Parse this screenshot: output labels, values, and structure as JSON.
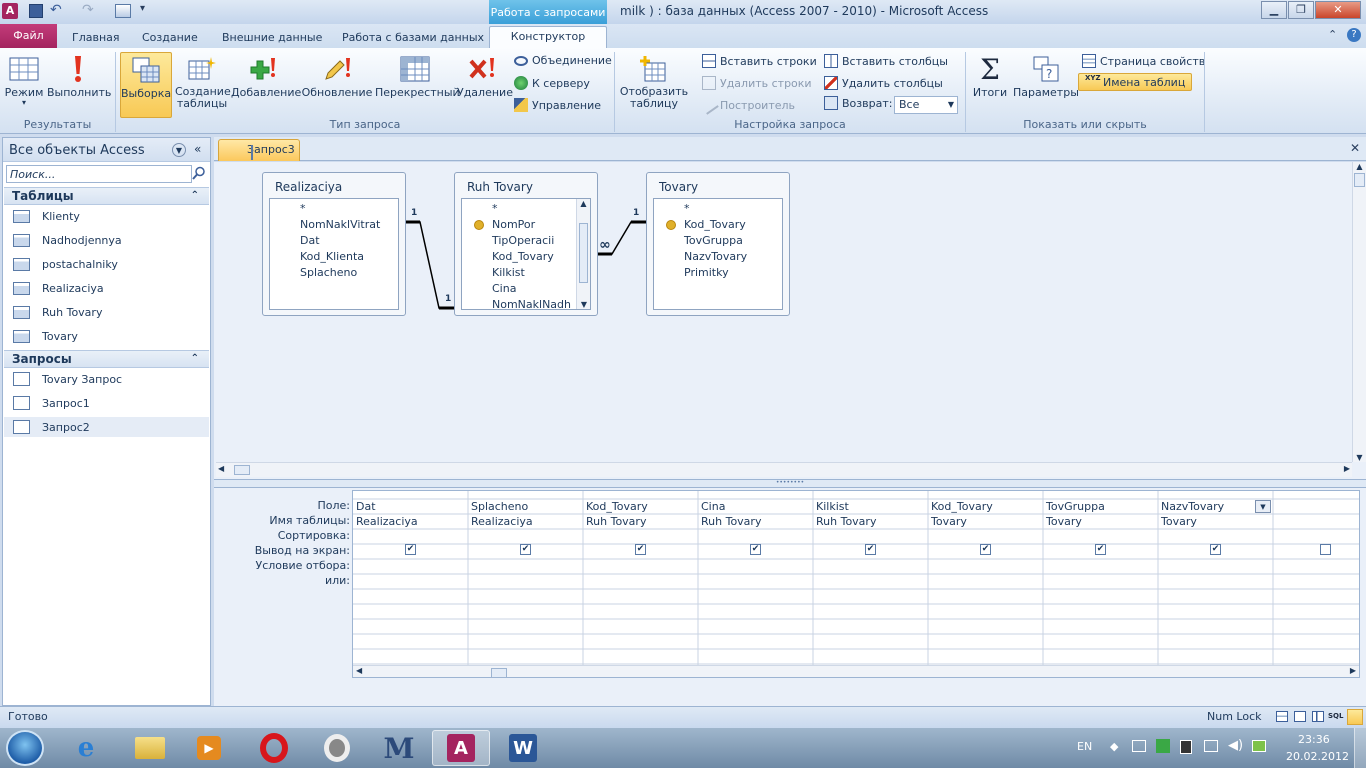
{
  "window": {
    "title": "milk ) : база данных (Access 2007 - 2010)  -  Microsoft Access",
    "context_tab_header": "Работа с запросами"
  },
  "tabs": {
    "file": "Файл",
    "items": [
      "Главная",
      "Создание",
      "Внешние данные",
      "Работа с базами данных",
      "Конструктор"
    ]
  },
  "ribbon": {
    "results": {
      "label": "Результаты",
      "mode": "Режим",
      "run": "Выполнить"
    },
    "query_type": {
      "label": "Тип запроса",
      "select": "Выборка",
      "make_table_1": "Создание",
      "make_table_2": "таблицы",
      "append": "Добавление",
      "update": "Обновление",
      "crosstab": "Перекрестный",
      "delete": "Удаление",
      "union": "Объединение",
      "to_server": "К серверу",
      "manage": "Управление"
    },
    "query_setup": {
      "label": "Настройка запроса",
      "show_table_1": "Отобразить",
      "show_table_2": "таблицу",
      "insert_rows": "Вставить строки",
      "delete_rows": "Удалить строки",
      "builder": "Построитель",
      "insert_columns": "Вставить столбцы",
      "delete_columns": "Удалить столбцы",
      "return_label": "Возврат:",
      "return_value": "Все"
    },
    "show_hide": {
      "label": "Показать или скрыть",
      "totals": "Итоги",
      "parameters": "Параметры",
      "property_sheet": "Страница свойств",
      "table_names": "Имена таблиц"
    }
  },
  "nav": {
    "title": "Все объекты Access",
    "search_placeholder": "Поиск...",
    "tables_header": "Таблицы",
    "tables": [
      "Klienty",
      "Nadhodjennya",
      "postachalniky",
      "Realizaciya",
      "Ruh Tovary",
      "Tovary"
    ],
    "queries_header": "Запросы",
    "queries": [
      "Tovary Запрос",
      "Запрос1",
      "Запрос2"
    ]
  },
  "document": {
    "tab": "Запрос3"
  },
  "diagram": {
    "tables": [
      {
        "name": "Realizaciya",
        "fields": [
          "*",
          "NomNaklVitrat",
          "Dat",
          "Kod_Klienta",
          "Splacheno"
        ]
      },
      {
        "name": "Ruh Tovary",
        "fields": [
          "*",
          "NomPor",
          "TipOperacii",
          "Kod_Tovary",
          "Kilkist",
          "Cina",
          "NomNaklNadh"
        ]
      },
      {
        "name": "Tovary",
        "fields": [
          "*",
          "Kod_Tovary",
          "TovGruppa",
          "NazvTovary",
          "Primitky"
        ]
      }
    ],
    "rel1": {
      "left": "1",
      "right": "1"
    },
    "rel2": {
      "left": "∞",
      "right": "1"
    }
  },
  "grid": {
    "row_labels": [
      "Поле:",
      "Имя таблицы:",
      "Сортировка:",
      "Вывод на экран:",
      "Условие отбора:",
      "или:"
    ],
    "columns": [
      {
        "field": "Dat",
        "table": "Realizaciya",
        "show": true
      },
      {
        "field": "Splacheno",
        "table": "Realizaciya",
        "show": true
      },
      {
        "field": "Kod_Tovary",
        "table": "Ruh Tovary",
        "show": true
      },
      {
        "field": "Cina",
        "table": "Ruh Tovary",
        "show": true
      },
      {
        "field": "Kilkist",
        "table": "Ruh Tovary",
        "show": true
      },
      {
        "field": "Kod_Tovary",
        "table": "Tovary",
        "show": true
      },
      {
        "field": "TovGruppa",
        "table": "Tovary",
        "show": true
      },
      {
        "field": "NazvTovary",
        "table": "Tovary",
        "show": true
      },
      {
        "field": "",
        "table": "",
        "show": false
      }
    ]
  },
  "status": {
    "left": "Готово",
    "num_lock": "Num Lock"
  },
  "taskbar": {
    "lang": "EN",
    "time": "23:36",
    "date": "20.02.2012"
  }
}
